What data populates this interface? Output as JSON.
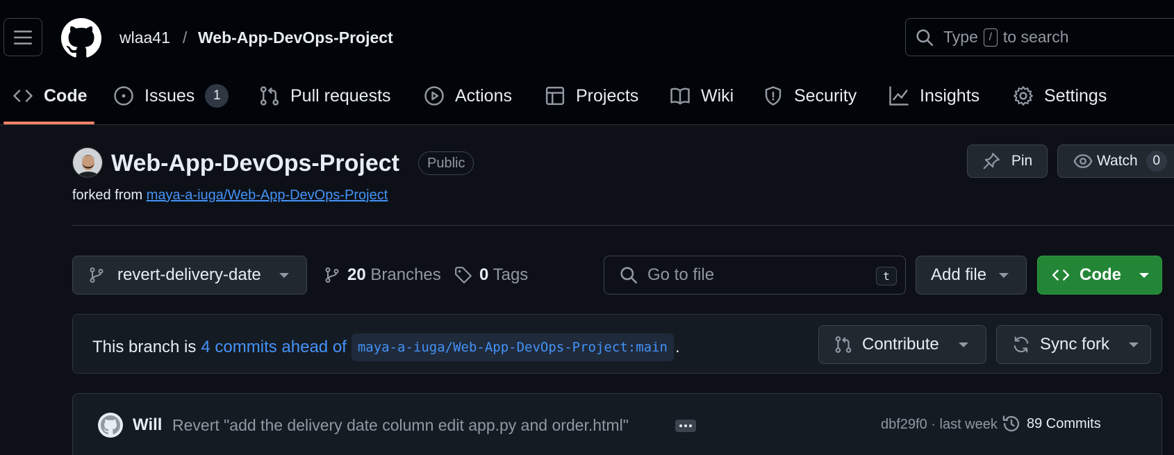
{
  "header": {
    "owner": "wlaa41",
    "separator": "/",
    "repo": "Web-App-DevOps-Project",
    "search_prefix": "Type",
    "search_key": "/",
    "search_suffix": "to search"
  },
  "tabs": [
    {
      "label": "Code",
      "icon": "code-icon",
      "active": true
    },
    {
      "label": "Issues",
      "icon": "issue-opened-icon",
      "count": "1"
    },
    {
      "label": "Pull requests",
      "icon": "git-pull-request-icon"
    },
    {
      "label": "Actions",
      "icon": "play-icon"
    },
    {
      "label": "Projects",
      "icon": "table-icon"
    },
    {
      "label": "Wiki",
      "icon": "book-icon"
    },
    {
      "label": "Security",
      "icon": "shield-icon"
    },
    {
      "label": "Insights",
      "icon": "graph-icon"
    },
    {
      "label": "Settings",
      "icon": "gear-icon"
    }
  ],
  "repo": {
    "title": "Web-App-DevOps-Project",
    "visibility": "Public",
    "forked_prefix": "forked from",
    "forked_from": "maya-a-iuga/Web-App-DevOps-Project",
    "pin_label": "Pin",
    "watch_label": "Watch",
    "watch_count": "0"
  },
  "file_nav": {
    "branch": "revert-delivery-date",
    "branches_count": "20",
    "branches_label": "Branches",
    "tags_count": "0",
    "tags_label": "Tags",
    "goto_placeholder": "Go to file",
    "goto_key": "t",
    "add_file_label": "Add file",
    "code_label": "Code"
  },
  "fork_status": {
    "prefix": "This branch is",
    "ahead": "4 commits ahead of",
    "base": "maya-a-iuga/Web-App-DevOps-Project:main",
    "suffix": ".",
    "contribute_label": "Contribute",
    "sync_label": "Sync fork"
  },
  "latest_commit": {
    "author": "Will",
    "message": "Revert \"add the delivery date column edit app.py and order.html\"",
    "sha_time": "dbf29f0 · last week",
    "commits_label": "89 Commits"
  },
  "colors": {
    "accent_link": "#4493f8",
    "tab_underline": "#f78166",
    "primary_button": "#238636",
    "background": "#0d1117"
  }
}
